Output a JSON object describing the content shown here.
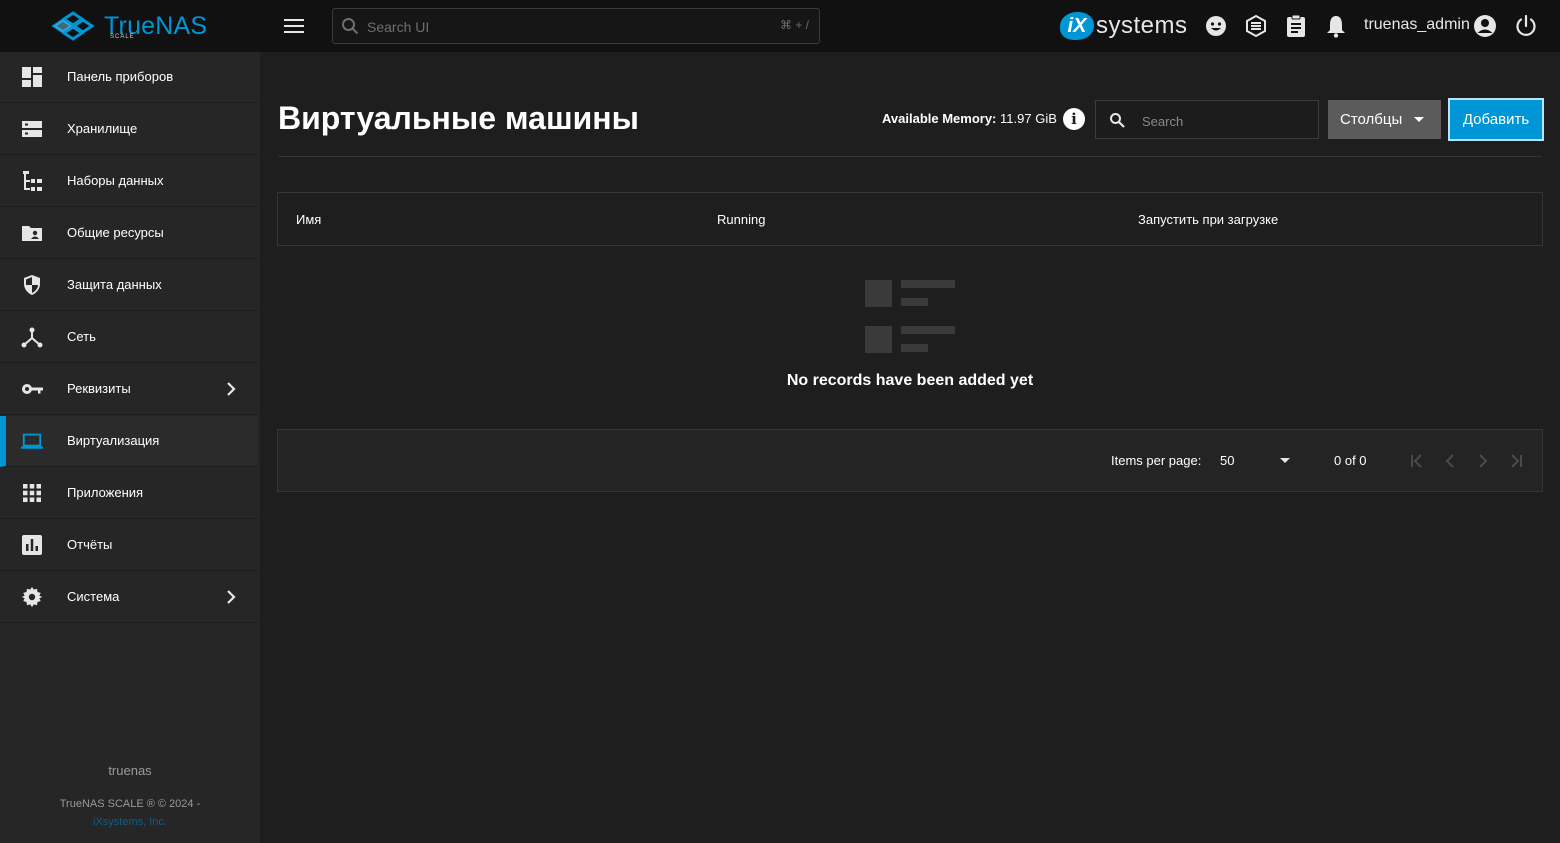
{
  "topbar": {
    "brand": "TrueNAS",
    "brand_sub": "SCALE",
    "search_placeholder": "Search UI",
    "search_shortcut": "⌘ + /",
    "vendor_logo_text": "systems",
    "vendor_logo_badge": "iX",
    "username": "truenas_admin",
    "icons": [
      "menu-icon",
      "feedback-icon",
      "truecommand-icon",
      "jobs-icon",
      "bell-icon",
      "account-icon",
      "power-icon"
    ]
  },
  "sidebar": {
    "items": [
      {
        "label": "Панель приборов",
        "icon": "dashboard-icon"
      },
      {
        "label": "Хранилище",
        "icon": "storage-icon"
      },
      {
        "label": "Наборы данных",
        "icon": "datasets-icon"
      },
      {
        "label": "Общие ресурсы",
        "icon": "shares-icon"
      },
      {
        "label": "Защита данных",
        "icon": "shield-icon"
      },
      {
        "label": "Сеть",
        "icon": "network-icon"
      },
      {
        "label": "Реквизиты",
        "icon": "key-icon",
        "has_children": true
      },
      {
        "label": "Виртуализация",
        "icon": "laptop-icon",
        "active": true
      },
      {
        "label": "Приложения",
        "icon": "apps-grid-icon"
      },
      {
        "label": "Отчёты",
        "icon": "reports-icon"
      },
      {
        "label": "Система",
        "icon": "gear-icon",
        "has_children": true
      }
    ],
    "hostname": "truenas",
    "copyright": "TrueNAS SCALE ® © 2024 -",
    "company_link": "iXsystems, Inc."
  },
  "main": {
    "title": "Виртуальные машины",
    "memory_label": "Available Memory:",
    "memory_value": "11.97 GiB",
    "search_placeholder": "Search",
    "columns_button": "Столбцы",
    "add_button": "Добавить",
    "table": {
      "headers": [
        "Имя",
        "Running",
        "Запустить при загрузке"
      ],
      "rows": [],
      "empty_message": "No records have been added yet"
    },
    "paginator": {
      "items_per_page_label": "Items per page:",
      "items_per_page_value": "50",
      "range": "0 of 0"
    }
  },
  "colors": {
    "accent": "#0095d5",
    "background": "#1e1e1e",
    "sidebar": "#262626",
    "topbar": "#111111"
  }
}
